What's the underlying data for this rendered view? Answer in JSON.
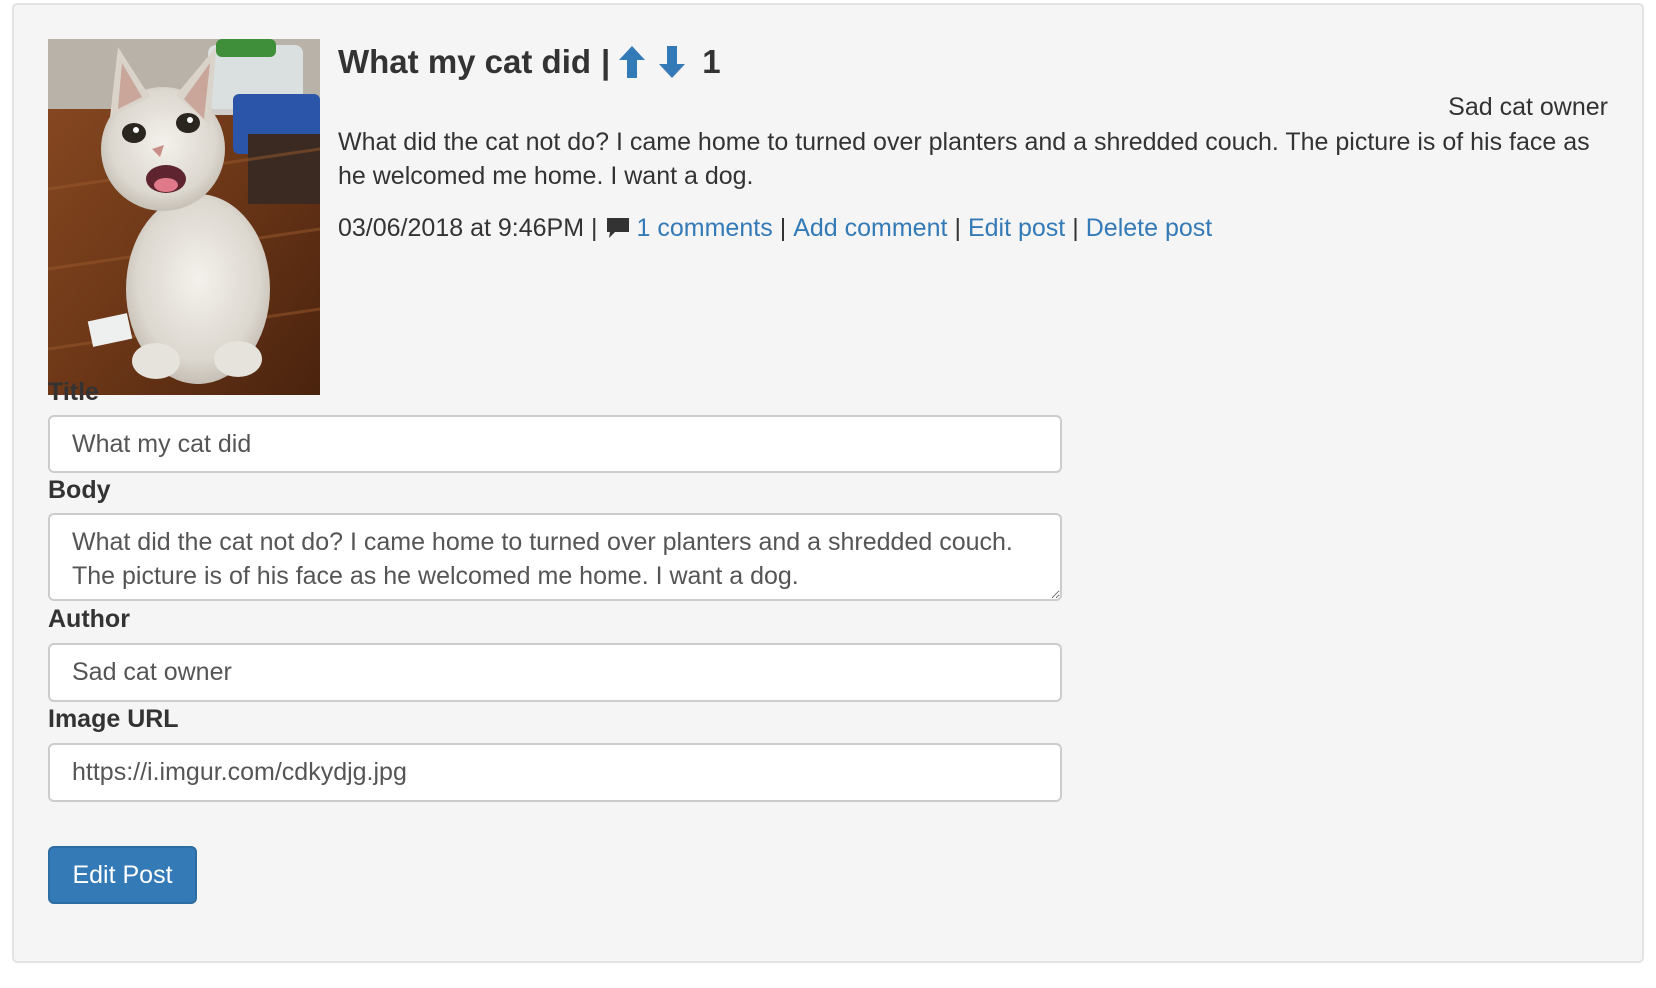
{
  "post": {
    "title": "What my cat did",
    "title_separator": "|",
    "vote_count": "1",
    "author": "Sad cat owner",
    "body": "What did the cat not do? I came home to turned over planters and a shredded couch. The picture is of his face as he welcomed me home. I want a dog.",
    "timestamp": "03/06/2018 at 9:46PM",
    "icons": {
      "upvote": "arrow-up-icon",
      "downvote": "arrow-down-icon",
      "comments": "comment-icon"
    },
    "links": {
      "comments": "1 comments",
      "add_comment": "Add comment",
      "edit_post": "Edit post",
      "delete_post": "Delete post"
    },
    "meta_separator": "|"
  },
  "form": {
    "title_label": "Title",
    "title_value": "What my cat did",
    "body_label": "Body",
    "body_value": "What did the cat not do? I came home to turned over planters and a shredded couch. The picture is of his face as he welcomed me home. I want a dog.",
    "author_label": "Author",
    "author_value": "Sad cat owner",
    "image_url_label": "Image URL",
    "image_url_value": "https://i.imgur.com/cdkydjg.jpg",
    "submit_label": "Edit Post"
  },
  "colors": {
    "link": "#337ab7",
    "button": "#337ab7",
    "panel_bg": "#f5f5f5",
    "text": "#333333"
  }
}
